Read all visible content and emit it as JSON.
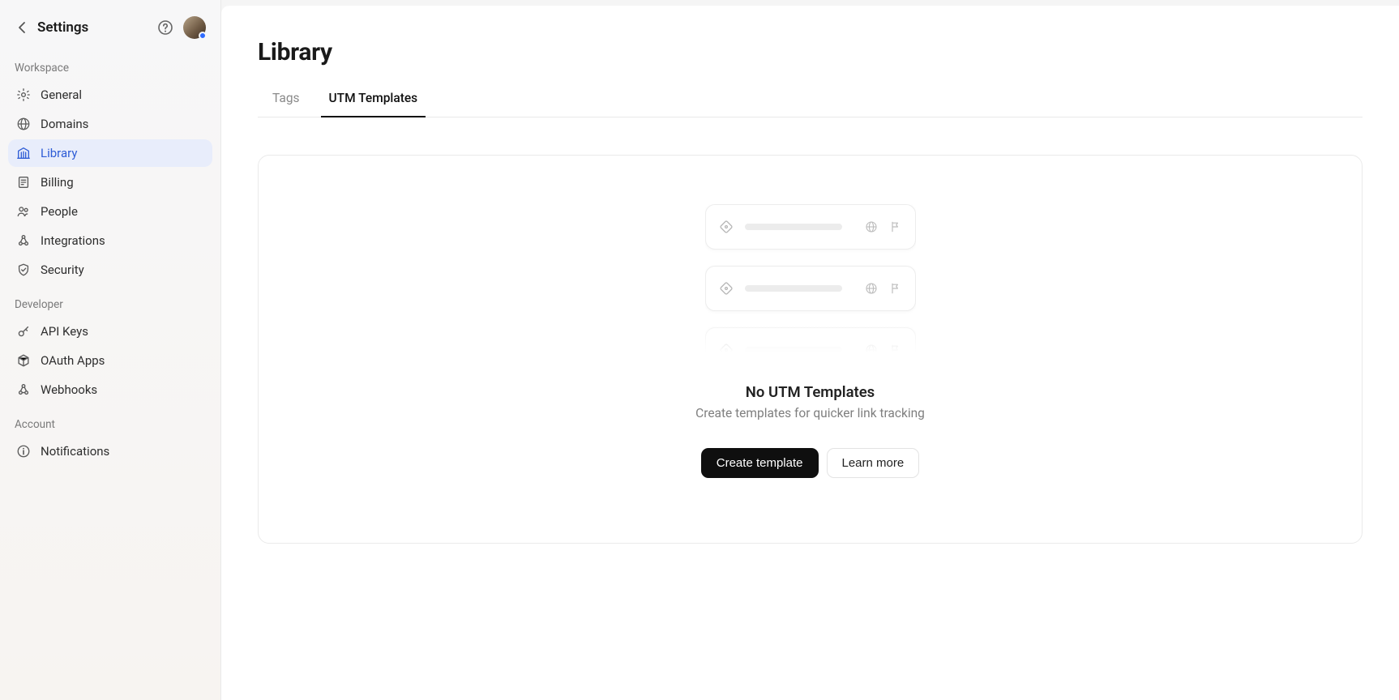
{
  "header": {
    "title": "Settings"
  },
  "sidebar": {
    "sections": [
      {
        "label": "Workspace",
        "items": [
          {
            "id": "general",
            "label": "General",
            "icon": "gear-icon",
            "active": false
          },
          {
            "id": "domains",
            "label": "Domains",
            "icon": "globe-icon",
            "active": false
          },
          {
            "id": "library",
            "label": "Library",
            "icon": "library-icon",
            "active": true
          },
          {
            "id": "billing",
            "label": "Billing",
            "icon": "receipt-icon",
            "active": false
          },
          {
            "id": "people",
            "label": "People",
            "icon": "people-icon",
            "active": false
          },
          {
            "id": "integrations",
            "label": "Integrations",
            "icon": "webhook-icon",
            "active": false
          },
          {
            "id": "security",
            "label": "Security",
            "icon": "shield-icon",
            "active": false
          }
        ]
      },
      {
        "label": "Developer",
        "items": [
          {
            "id": "api-keys",
            "label": "API Keys",
            "icon": "key-icon",
            "active": false
          },
          {
            "id": "oauth-apps",
            "label": "OAuth Apps",
            "icon": "cube-icon",
            "active": false
          },
          {
            "id": "webhooks",
            "label": "Webhooks",
            "icon": "webhook-icon",
            "active": false
          }
        ]
      },
      {
        "label": "Account",
        "items": [
          {
            "id": "notifications",
            "label": "Notifications",
            "icon": "info-icon",
            "active": false
          }
        ]
      }
    ]
  },
  "page": {
    "title": "Library",
    "tabs": [
      {
        "id": "tags",
        "label": "Tags",
        "active": false
      },
      {
        "id": "utm-templates",
        "label": "UTM Templates",
        "active": true
      }
    ],
    "empty_state": {
      "title": "No UTM Templates",
      "subtitle": "Create templates for quicker link tracking",
      "primary_button": "Create template",
      "secondary_button": "Learn more"
    }
  }
}
